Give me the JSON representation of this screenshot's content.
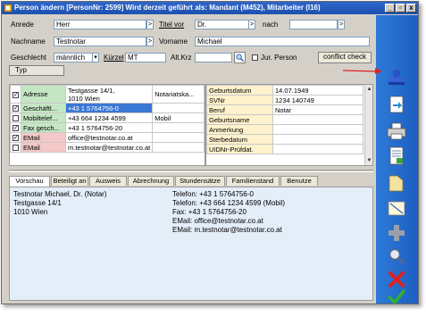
{
  "window": {
    "title": "Person ändern  [PersonNr: 2599] Wird derzeit geführt als: Mandant (M452), Mitarbeiter (I16)",
    "min": "_",
    "restore": "▫",
    "close": "x"
  },
  "form": {
    "anrede_label": "Anrede",
    "anrede_value": "Herr",
    "titel_vor_label": "Titel vor",
    "titel_vor_value": "Dr.",
    "nach_label": "nach",
    "nach_value": "",
    "nachname_label": "Nachname",
    "nachname_value": "Testnotar",
    "vorname_label": "Vorname",
    "vorname_value": "Michael",
    "geschlecht_label": "Geschlecht",
    "geschlecht_value": "männlich",
    "kuerzel_label": "Kürzel",
    "kuerzel_value": "MT",
    "altkrz_label": "Alt.Krz",
    "altkrz_value": "",
    "jur_person_label": "Jur. Person",
    "conflict_check_label": "conflict check",
    "typ_label": "Typ"
  },
  "contacts": [
    {
      "checked": true,
      "color": "#c4e6c4",
      "label": "Adresse",
      "value": "Testgasse 14/1,",
      "value2": "1010 Wien",
      "extra": "Notariatska..."
    },
    {
      "checked": true,
      "color": "#c4e6c4",
      "label": "Geschäftl...",
      "value": "+43 1 5764756-0",
      "value2": "",
      "extra": "",
      "selected": true
    },
    {
      "checked": false,
      "color": "#c4e6c4",
      "label": "Mobiltelef...",
      "value": "+43 664 1234 4599",
      "value2": "",
      "extra": "Mobil"
    },
    {
      "checked": true,
      "color": "#c4e6c4",
      "label": "Fax gesch...",
      "value": "+43 1 5764756-20",
      "value2": "",
      "extra": ""
    },
    {
      "checked": true,
      "color": "#f4c8c8",
      "label": "EMail",
      "value": "office@testnotar.co.at",
      "value2": "",
      "extra": ""
    },
    {
      "checked": false,
      "color": "#f4c8c8",
      "label": "EMail",
      "value": "m.testnotar@testnotar.co.at",
      "value2": "",
      "extra": ""
    }
  ],
  "details": [
    {
      "label": "Geburtsdatum",
      "value": "14.07.1949"
    },
    {
      "label": "SVNr",
      "value": "1234 140749"
    },
    {
      "label": "Beruf",
      "value": "Notar"
    },
    {
      "label": "Geburtsname",
      "value": ""
    },
    {
      "label": "Anmerkung",
      "value": ""
    },
    {
      "label": "Sterbedatum",
      "value": ""
    },
    {
      "label": "UIDNr-Prüfdat.",
      "value": ""
    }
  ],
  "tabs": [
    "Vorschau",
    "Beteiligt an",
    "Ausweis",
    "Abrechnung",
    "Stundensätze",
    "Familienstand",
    "Benutze"
  ],
  "preview": {
    "left": [
      "Testnotar Michael, Dr. (Notar)",
      "Testgasse 14/1",
      "1010 Wien"
    ],
    "right": [
      "Telefon: +43 1 5764756-0",
      "Telefon: +43 664 1234 4599 (Mobil)",
      "Fax: +43 1 5764756-20",
      "EMail: office@testnotar.co.at",
      "EMail: m.testnotar@testnotar.co.at"
    ]
  },
  "sidebar_icons": [
    "stamp-icon",
    "export-icon",
    "print-icon",
    "document-icon",
    "folder-icon",
    "note-icon",
    "add-icon",
    "search-icon",
    "cancel-icon",
    "ok-icon"
  ],
  "colors": {
    "titlebar": "#1d50b0",
    "sidepanel": "#1c5fc1",
    "selection": "#3a78d6",
    "arrow": "#e02020"
  }
}
